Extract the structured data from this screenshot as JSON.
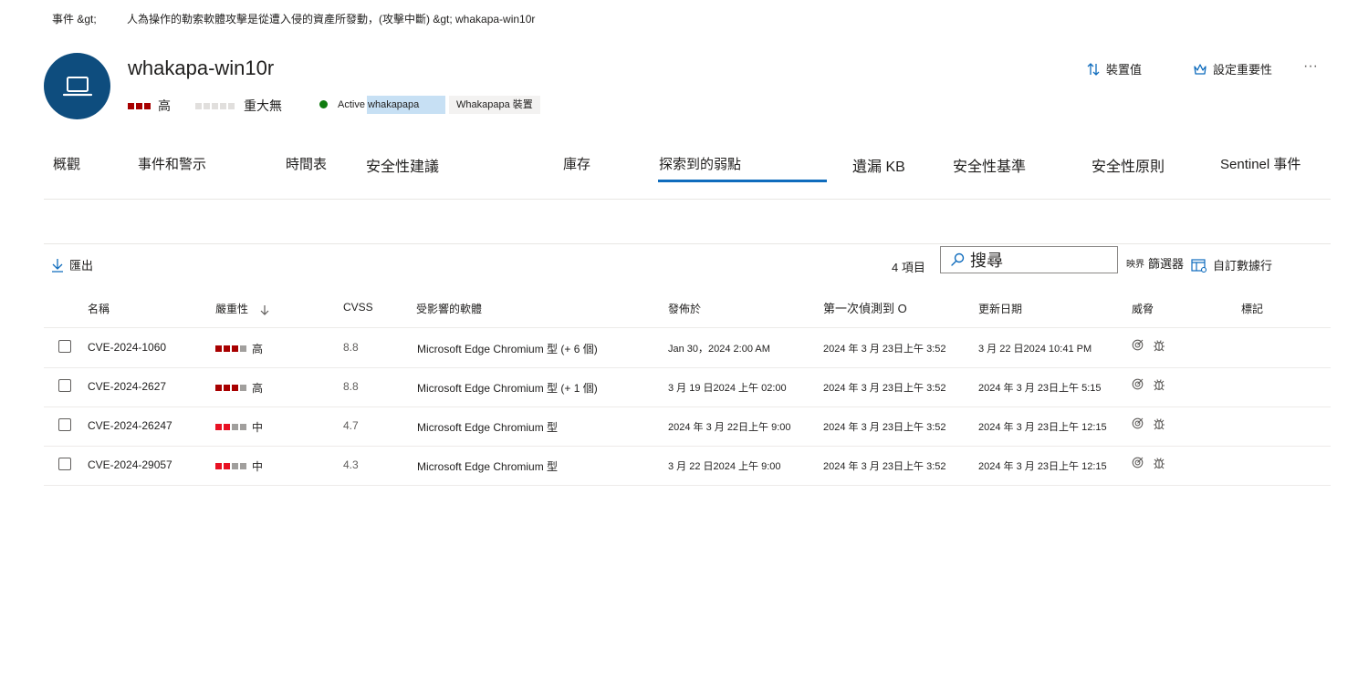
{
  "breadcrumb": {
    "incidents": "事件 &gt;",
    "incident_name": "人為操作的勒索軟體攻擊是從遭入侵的資產所發動，(攻擊中斷) &gt; whakapa-win10r"
  },
  "device": {
    "name": "whakapa-win10r",
    "risk_label": "高",
    "criticality_label": "重大無",
    "status_tag": "Active whakapapa",
    "device_tag": "Whakapapa 裝置",
    "status_color": "#107c10"
  },
  "header_actions": {
    "device_value": "裝置值",
    "set_criticality": "設定重要性",
    "more": "···"
  },
  "tabs": [
    {
      "label": "概觀"
    },
    {
      "label": "事件和警示"
    },
    {
      "label": "時間表"
    },
    {
      "label": "安全性建議"
    },
    {
      "label": "庫存"
    },
    {
      "label": "探索到的弱點",
      "selected": true
    },
    {
      "label": "遺漏 KB"
    },
    {
      "label": "安全性基準"
    },
    {
      "label": "安全性原則"
    },
    {
      "label": "Sentinel 事件"
    }
  ],
  "toolbar": {
    "export": "匯出",
    "count": "4 項目",
    "search_placeholder": "搜尋",
    "filters": "篩選器",
    "filter_prefix": "映界",
    "customize_columns": "自訂數據行"
  },
  "columns": {
    "name": "名稱",
    "severity": "嚴重性",
    "cvss": "CVSS",
    "software": "受影響的軟體",
    "published": "發佈於",
    "first_detected": "第一次偵測到 O",
    "updated": "更新日期",
    "threats": "威脅",
    "tags": "標記"
  },
  "colors": {
    "high": "#a80000",
    "medium": "#e81123",
    "inactive": "#a19f9d",
    "accent": "#0f6cbd",
    "avatar": "#0e4d7e"
  },
  "rows": [
    {
      "name": "CVE-2024-1060",
      "severity": "高",
      "level": 3,
      "cvss": "8.8",
      "software": "Microsoft Edge Chromium 型 (+ 6 個)",
      "published": "Jan 30，2024 2:00 AM",
      "first_detected": "2024 年 3 月 23日上午 3:52",
      "updated": "3 月 22 日2024 10:41 PM"
    },
    {
      "name": "CVE-2024-2627",
      "severity": "高",
      "level": 3,
      "cvss": "8.8",
      "software": "Microsoft Edge Chromium 型 (+ 1 個)",
      "published": "3 月 19 日2024 上午 02:00",
      "first_detected": "2024 年 3 月 23日上午 3:52",
      "updated": "2024 年 3 月 23日上午 5:15"
    },
    {
      "name": "CVE-2024-26247",
      "severity": "中",
      "level": 2,
      "cvss": "4.7",
      "software": "Microsoft Edge Chromium 型",
      "published": "2024 年 3 月 22日上午 9:00",
      "first_detected": "2024 年 3 月 23日上午 3:52",
      "updated": "2024 年 3 月 23日上午 12:15"
    },
    {
      "name": "CVE-2024-29057",
      "severity": "中",
      "level": 2,
      "cvss": "4.3",
      "software": "Microsoft Edge Chromium 型",
      "published": "3 月 22 日2024 上午 9:00",
      "first_detected": "2024 年 3 月 23日上午 3:52",
      "updated": "2024 年 3 月 23日上午 12:15"
    }
  ]
}
